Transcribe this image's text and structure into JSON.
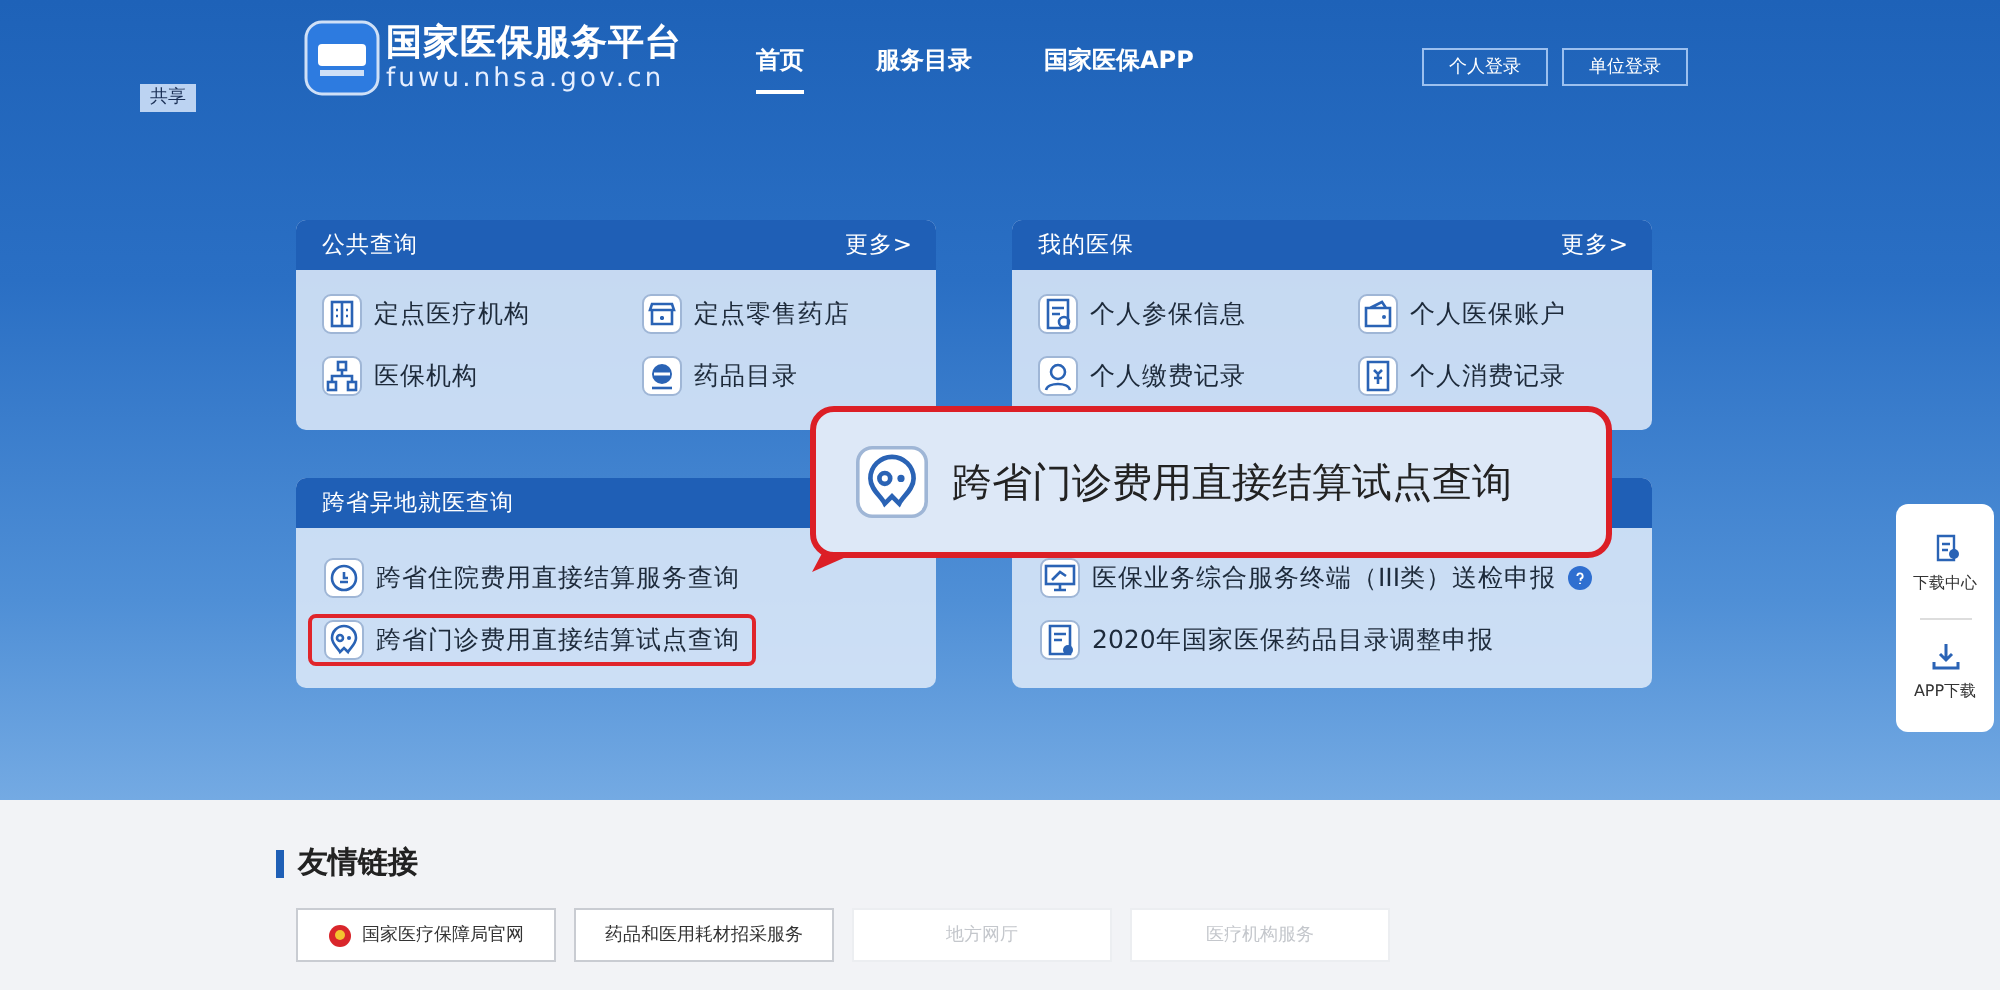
{
  "header": {
    "share_badge": "共享",
    "logo": {
      "title": "国家医保服务平台",
      "url": "fuwu.nhsa.gov.cn"
    },
    "nav": [
      {
        "label": "首页",
        "selected": true
      },
      {
        "label": "服务目录",
        "selected": false
      },
      {
        "label": "国家医保APP",
        "selected": false
      }
    ],
    "login_buttons": [
      "个人登录",
      "单位登录"
    ]
  },
  "panels": [
    {
      "title": "公共查询",
      "more": "更多>",
      "kind": "grid",
      "items": [
        {
          "label": "定点医疗机构",
          "highlighted": false
        },
        {
          "label": "定点零售药店",
          "highlighted": false
        },
        {
          "label": "医保机构",
          "highlighted": false
        },
        {
          "label": "药品目录",
          "highlighted": false
        }
      ]
    },
    {
      "title": "我的医保",
      "more": "更多>",
      "kind": "grid",
      "items": [
        {
          "label": "个人参保信息",
          "highlighted": false
        },
        {
          "label": "个人医保账户",
          "highlighted": false
        },
        {
          "label": "个人缴费记录",
          "highlighted": false
        },
        {
          "label": "个人消费记录",
          "highlighted": false
        }
      ]
    },
    {
      "title": "跨省异地就医查询",
      "kind": "list",
      "items": [
        {
          "label": "跨省住院费用直接结算服务查询",
          "highlighted": false
        },
        {
          "label": "跨省门诊费用直接结算试点查询",
          "highlighted": true
        }
      ]
    },
    {
      "kind": "list",
      "items": [
        {
          "label": "医保业务综合服务终端（III类）送检申报",
          "highlighted": false,
          "help": true
        },
        {
          "label": "2020年国家医保药品目录调整申报",
          "highlighted": false,
          "help": false
        }
      ]
    }
  ],
  "callout": {
    "label": "跨省门诊费用直接结算试点查询"
  },
  "side_toolbar": [
    {
      "label": "下载中心"
    },
    {
      "label": "APP下载"
    }
  ],
  "links": {
    "title": "友情链接",
    "items": [
      {
        "label": "国家医疗保障局官网",
        "disabled": false,
        "emblem": true
      },
      {
        "label": "药品和医用耗材招采服务",
        "disabled": false,
        "emblem": false
      },
      {
        "label": "地方网厅",
        "disabled": true,
        "emblem": false
      },
      {
        "label": "医疗机构服务",
        "disabled": true,
        "emblem": false
      }
    ]
  }
}
